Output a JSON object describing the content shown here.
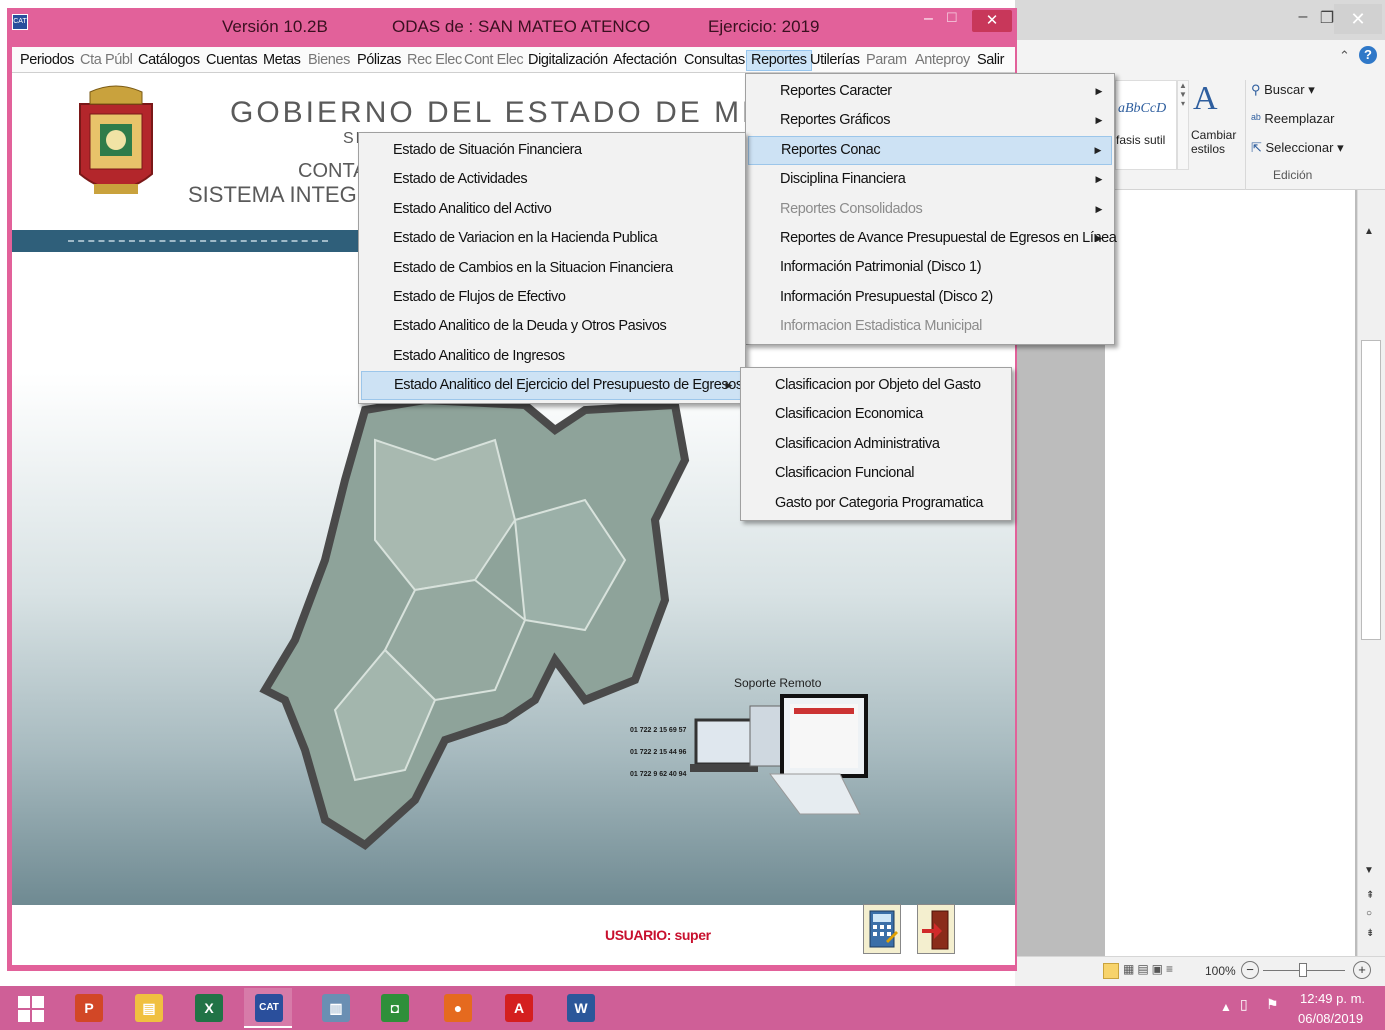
{
  "app": {
    "title_version": "Versión 10.2B",
    "title_odas": "ODAS de : SAN MATEO ATENCO",
    "title_ejercicio": "Ejercicio: 2019",
    "close_glyph": "✕",
    "minimize_glyph": "–",
    "maximize_glyph": "☐"
  },
  "menubar": [
    {
      "label": "Periodos",
      "state": "normal"
    },
    {
      "label": "Cta Públ",
      "state": "disabled"
    },
    {
      "label": "Catálogos",
      "state": "normal"
    },
    {
      "label": "Cuentas",
      "state": "normal"
    },
    {
      "label": "Metas",
      "state": "normal"
    },
    {
      "label": "Bienes",
      "state": "disabled"
    },
    {
      "label": "Pólizas",
      "state": "normal"
    },
    {
      "label": "Rec Elec",
      "state": "disabled"
    },
    {
      "label": "Cont Elec",
      "state": "disabled"
    },
    {
      "label": "Digitalización",
      "state": "normal"
    },
    {
      "label": "Afectación",
      "state": "normal"
    },
    {
      "label": "Consultas",
      "state": "normal"
    },
    {
      "label": "Reportes",
      "state": "active"
    },
    {
      "label": "Utilerías",
      "state": "normal"
    },
    {
      "label": "Param",
      "state": "disabled"
    },
    {
      "label": "Anteproy",
      "state": "disabled"
    },
    {
      "label": "Salir",
      "state": "normal"
    }
  ],
  "header": {
    "gobierno": "GOBIERNO DEL ESTADO DE MÉXICO",
    "secretaria": "SE",
    "conta": "CONTA",
    "sistema": "SISTEMA INTEGRA"
  },
  "reportes_menu": [
    {
      "label": "Reportes Caracter",
      "submenu": true,
      "disabled": false,
      "highlighted": false
    },
    {
      "label": "Reportes Gráficos",
      "submenu": true,
      "disabled": false,
      "highlighted": false
    },
    {
      "label": "Reportes Conac",
      "submenu": true,
      "disabled": false,
      "highlighted": true
    },
    {
      "label": "Disciplina Financiera",
      "submenu": true,
      "disabled": false,
      "highlighted": false
    },
    {
      "label": "Reportes Consolidados",
      "submenu": true,
      "disabled": true,
      "highlighted": false
    },
    {
      "label": "Reportes de Avance Presupuestal de Egresos en Línea",
      "submenu": true,
      "disabled": false,
      "highlighted": false
    },
    {
      "label": "Información Patrimonial (Disco 1)",
      "submenu": false,
      "disabled": false,
      "highlighted": false
    },
    {
      "label": "Información Presupuestal (Disco 2)",
      "submenu": false,
      "disabled": false,
      "highlighted": false
    },
    {
      "label": "Informacion Estadistica Municipal",
      "submenu": false,
      "disabled": true,
      "highlighted": false
    }
  ],
  "conac_menu": [
    {
      "label": "Estado de Situación Financiera",
      "submenu": false,
      "highlighted": false
    },
    {
      "label": "Estado de Actividades",
      "submenu": false,
      "highlighted": false
    },
    {
      "label": "Estado Analitico del Activo",
      "submenu": false,
      "highlighted": false
    },
    {
      "label": "Estado de Variacion en la Hacienda Publica",
      "submenu": false,
      "highlighted": false
    },
    {
      "label": "Estado de Cambios en la Situacion Financiera",
      "submenu": false,
      "highlighted": false
    },
    {
      "label": "Estado de Flujos de Efectivo",
      "submenu": false,
      "highlighted": false
    },
    {
      "label": "Estado Analitico de la Deuda y Otros Pasivos",
      "submenu": false,
      "highlighted": false
    },
    {
      "label": "Estado Analitico de Ingresos",
      "submenu": false,
      "highlighted": false
    },
    {
      "label": "Estado Analitico del Ejercicio del Presupuesto de Egresos",
      "submenu": true,
      "highlighted": true
    }
  ],
  "egresos_menu": [
    {
      "label": "Clasificacion por Objeto del Gasto"
    },
    {
      "label": "Clasificacion Economica"
    },
    {
      "label": "Clasificacion Administrativa"
    },
    {
      "label": "Clasificacion Funcional"
    },
    {
      "label": "Gasto por Categoria Programatica"
    }
  ],
  "soporte": {
    "label": "Soporte Remoto",
    "phones": [
      "01 722 2 15 69 57",
      "01 722 2 15 44 96",
      "01 722 9 62 40 94"
    ]
  },
  "usuario": "USUARIO: super",
  "word": {
    "styles_sample": "aBbCcD",
    "enfasis": "fasis sutil",
    "cambiar_estilos": "Cambiar estilos",
    "buscar": "Buscar",
    "reemplazar": "Reemplazar",
    "seleccionar": "Seleccionar",
    "edicion": "Edición",
    "zoom": "100%"
  },
  "taskbar": {
    "apps": [
      {
        "name": "powerpoint",
        "glyph": "P",
        "color": "#d24726",
        "active": false
      },
      {
        "name": "file-explorer",
        "glyph": "▤",
        "color": "#f0c040",
        "active": false
      },
      {
        "name": "excel",
        "glyph": "X",
        "color": "#217346",
        "active": false
      },
      {
        "name": "cat",
        "glyph": "CAT",
        "color": "#2a4f9c",
        "active": true
      },
      {
        "name": "image-viewer",
        "glyph": "▥",
        "color": "#6a8fb3",
        "active": false
      },
      {
        "name": "store",
        "glyph": "◘",
        "color": "#2f8f3a",
        "active": false
      },
      {
        "name": "firefox",
        "glyph": "●",
        "color": "#e56a1f",
        "active": false
      },
      {
        "name": "acrobat",
        "glyph": "A",
        "color": "#d41f1f",
        "active": false
      },
      {
        "name": "word",
        "glyph": "W",
        "color": "#2b579a",
        "active": false
      }
    ],
    "time": "12:49 p. m.",
    "date": "06/08/2019"
  }
}
